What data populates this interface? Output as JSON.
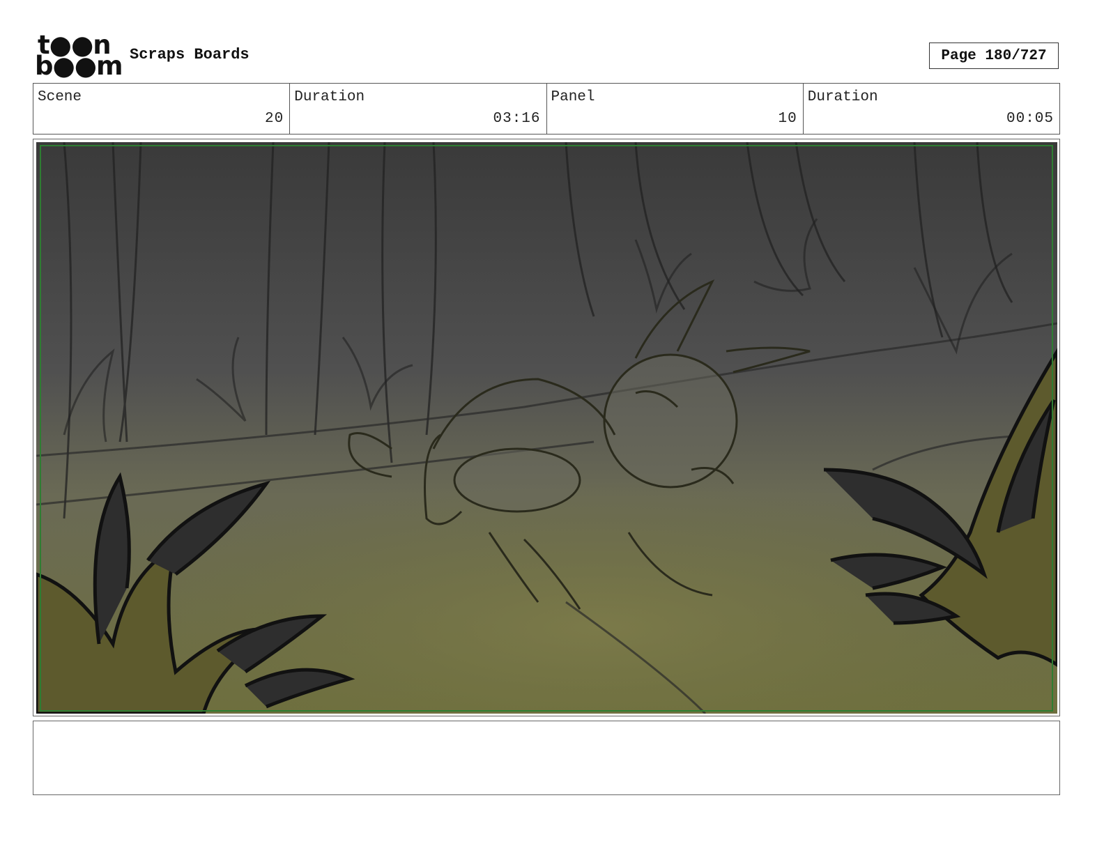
{
  "header": {
    "logo_line1": "t●●n",
    "logo_line2": "b●●m",
    "title": "Scraps Boards",
    "page_indicator": "Page 180/727"
  },
  "info": {
    "scene_label": "Scene",
    "scene_value": "20",
    "scene_duration_label": "Duration",
    "scene_duration_value": "03:16",
    "panel_label": "Panel",
    "panel_value": "10",
    "panel_duration_label": "Duration",
    "panel_duration_value": "00:05"
  },
  "notes": {
    "text": ""
  },
  "colors": {
    "safe_area_border": "#2e7d32",
    "forest_dark": "#3d3d3d",
    "ground_olive": "#6e6f3e",
    "plant_olive": "#5d5a2d",
    "plant_dark": "#2e2e2e"
  }
}
